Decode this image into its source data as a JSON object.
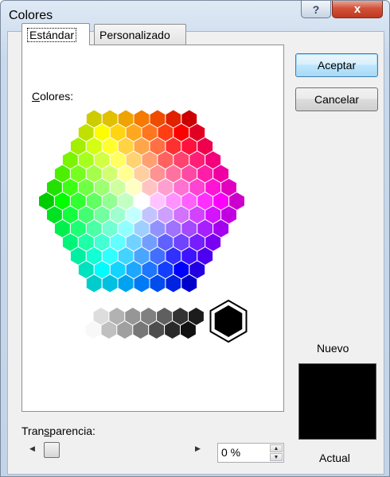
{
  "window": {
    "title": "Colores",
    "help_glyph": "?",
    "close_glyph": "x"
  },
  "tabs": [
    {
      "label": "Estándar",
      "active": true
    },
    {
      "label": "Personalizado",
      "active": false
    }
  ],
  "colors_label": "Colores:",
  "buttons": {
    "ok": "Aceptar",
    "cancel": "Cancelar"
  },
  "preview": {
    "new_label": "Nuevo",
    "current_label": "Actual",
    "new_color": "#000000",
    "current_color": "#000000"
  },
  "transparency": {
    "label": "Transparencia:",
    "value": "0 %",
    "fraction": 0
  },
  "selected_color": "#000000"
}
